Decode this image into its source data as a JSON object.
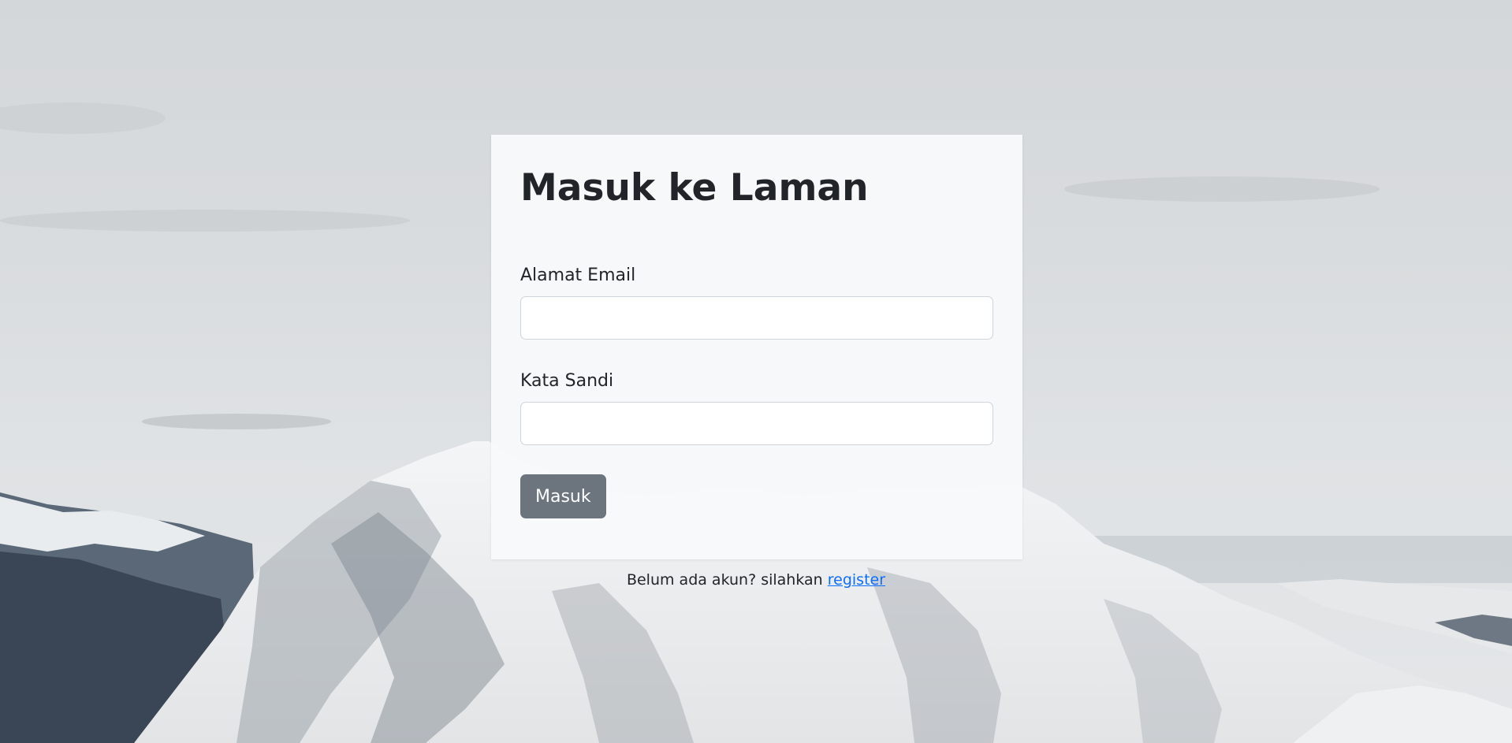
{
  "login": {
    "title": "Masuk ke Laman",
    "email_label": "Alamat Email",
    "email_value": "",
    "password_label": "Kata Sandi",
    "password_value": "",
    "submit_label": "Masuk"
  },
  "register": {
    "prompt": "Belum ada akun? silahkan ",
    "link_label": "register"
  },
  "colors": {
    "button": "#6c757d",
    "link": "#0d6efd",
    "card": "#f8f9fa"
  }
}
